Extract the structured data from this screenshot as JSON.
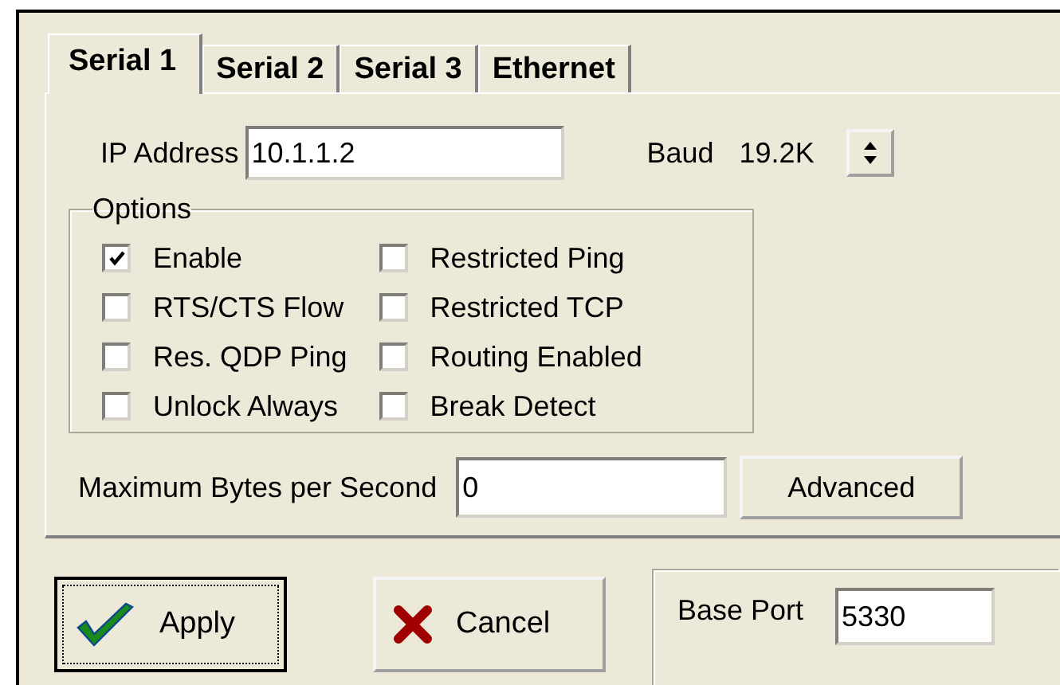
{
  "tabs": [
    {
      "label": "Serial 1",
      "selected": true
    },
    {
      "label": "Serial 2",
      "selected": false
    },
    {
      "label": "Serial 3",
      "selected": false
    },
    {
      "label": "Ethernet",
      "selected": false
    }
  ],
  "ip_address": {
    "label": "IP Address",
    "value": "10.1.1.2"
  },
  "baud": {
    "label": "Baud",
    "value": "19.2K"
  },
  "options": {
    "title": "Options",
    "columns": [
      [
        {
          "label": "Enable",
          "checked": true
        },
        {
          "label": "RTS/CTS Flow",
          "checked": false
        },
        {
          "label": "Res. QDP Ping",
          "checked": false
        },
        {
          "label": "Unlock Always",
          "checked": false
        }
      ],
      [
        {
          "label": "Restricted Ping",
          "checked": false
        },
        {
          "label": "Restricted TCP",
          "checked": false
        },
        {
          "label": "Routing Enabled",
          "checked": false
        },
        {
          "label": "Break Detect",
          "checked": false
        }
      ]
    ]
  },
  "max_bytes": {
    "label": "Maximum Bytes per Second",
    "value": "0"
  },
  "advanced_button": "Advanced",
  "buttons": [
    {
      "label": "Apply",
      "kind": "apply",
      "focused": true
    },
    {
      "label": "Cancel",
      "kind": "cancel",
      "focused": false
    }
  ],
  "base_port": {
    "label": "Base Port",
    "value": "5330"
  }
}
